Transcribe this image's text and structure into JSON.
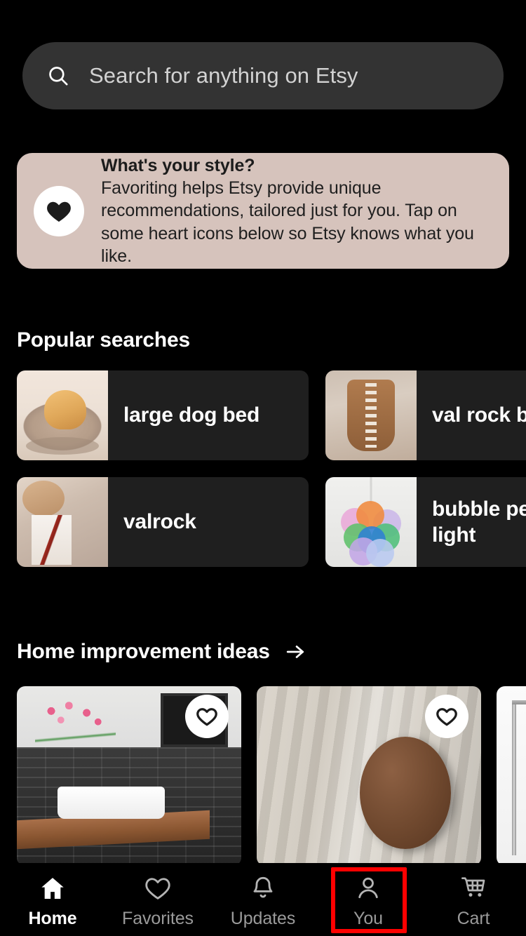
{
  "app": {
    "name": "Etsy",
    "theme": "dark",
    "background_color": "#000000"
  },
  "search": {
    "placeholder": "Search for anything on Etsy",
    "value": "",
    "icon": "search-icon",
    "background_color": "#333333"
  },
  "style_banner": {
    "icon": "heart-filled-icon",
    "title": "What's your style?",
    "body": "Favoriting helps Etsy provide unique recommendations, tailored just for you. Tap on some heart icons below so Etsy knows what you like.",
    "background_color": "#D6C3BC",
    "text_color": "#1C1C1C"
  },
  "popular_searches": {
    "title": "Popular searches",
    "items": [
      {
        "label": "large dog bed",
        "thumb": "golden-retriever-on-dog-bed"
      },
      {
        "label": "val rock b",
        "thumb": "corset-top"
      },
      {
        "label": "valrock",
        "thumb": "woman-in-embroidered-blouse"
      },
      {
        "label": "bubble pe\nlight",
        "thumb": "bubble-pendant-light"
      }
    ]
  },
  "home_improvement": {
    "title": "Home improvement ideas",
    "arrow_icon": "arrow-right-icon",
    "cards": [
      {
        "thumb": "bathroom-vessel-sink-with-tulips",
        "favorite_icon": "heart-outline-icon",
        "favorited": false
      },
      {
        "thumb": "wooden-curtain-tieback-holdback",
        "favorite_icon": "heart-outline-icon",
        "favorited": false
      },
      {
        "thumb": "metal-rod-hairpin-leg",
        "favorite_icon": "heart-outline-icon",
        "favorited": false
      }
    ]
  },
  "bottom_nav": {
    "active": "Home",
    "highlight": {
      "target": "You",
      "color": "#FF0000"
    },
    "items": [
      {
        "label": "Home",
        "icon": "home-icon",
        "active": true
      },
      {
        "label": "Favorites",
        "icon": "heart-outline-icon",
        "active": false
      },
      {
        "label": "Updates",
        "icon": "bell-icon",
        "active": false
      },
      {
        "label": "You",
        "icon": "person-icon",
        "active": false
      },
      {
        "label": "Cart",
        "icon": "cart-icon",
        "active": false
      }
    ]
  }
}
